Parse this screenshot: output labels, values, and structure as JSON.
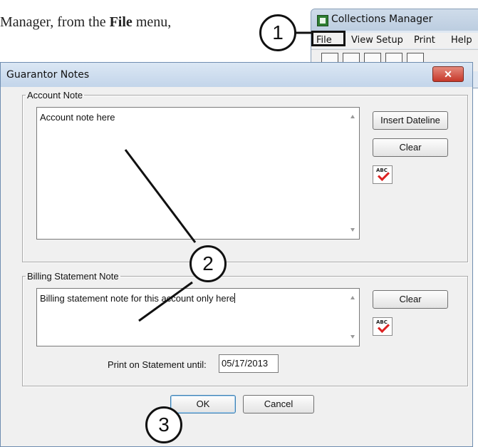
{
  "instruction": {
    "prefix": "Manager, from the ",
    "bold": "File",
    "suffix": " menu,"
  },
  "background_window": {
    "title": "Collections Manager",
    "menu": [
      "File",
      "View Setup",
      "Print",
      "Help"
    ]
  },
  "dialog": {
    "title": "Guarantor Notes",
    "close_label": "✕",
    "account_note": {
      "legend": "Account Note",
      "text": "Account note here",
      "insert_dateline_label": "Insert Dateline",
      "clear_label": "Clear"
    },
    "billing_note": {
      "legend": "Billing Statement Note",
      "text": "Billing statement note for this account only here",
      "clear_label": "Clear",
      "print_until_label": "Print on Statement until:",
      "print_until_value": "05/17/2013"
    },
    "ok_label": "OK",
    "cancel_label": "Cancel"
  },
  "callouts": [
    "1",
    "2",
    "3"
  ],
  "spell_icon_text": "ABC"
}
